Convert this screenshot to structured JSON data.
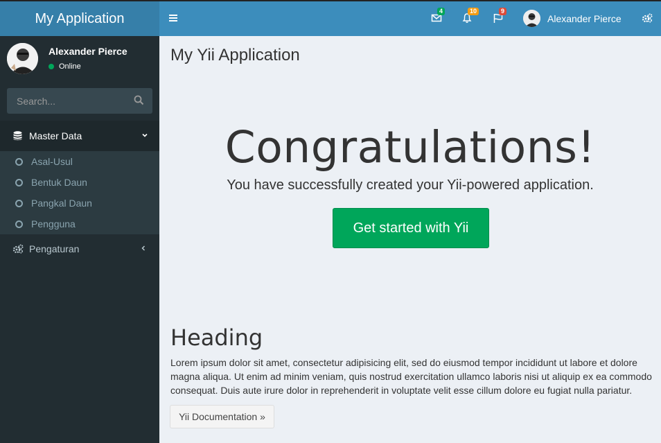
{
  "app": {
    "title": "My Application"
  },
  "navbar": {
    "messages_count": "4",
    "notifications_count": "10",
    "tasks_count": "9",
    "user_name": "Alexander Pierce",
    "colors": {
      "messages": "#00a65a",
      "notifications": "#f39c12",
      "tasks": "#dd4b39"
    }
  },
  "sidebar": {
    "user_name": "Alexander Pierce",
    "status": "Online",
    "search_placeholder": "Search...",
    "menu": [
      {
        "label": "Master Data",
        "icon": "database-icon",
        "expanded": true,
        "children": [
          "Asal-Usul",
          "Bentuk Daun",
          "Pangkal Daun",
          "Pengguna"
        ]
      },
      {
        "label": "Pengaturan",
        "icon": "gears-icon",
        "expanded": false
      }
    ]
  },
  "content": {
    "page_title": "My Yii Application",
    "jumbotron_title": "Congratulations!",
    "lead": "You have successfully created your Yii-powered application.",
    "cta_label": "Get started with Yii",
    "heading": "Heading",
    "paragraph": "Lorem ipsum dolor sit amet, consectetur adipisicing elit, sed do eiusmod tempor incididunt ut labore et dolore magna aliqua. Ut enim ad minim veniam, quis nostrud exercitation ullamco laboris nisi ut aliquip ex ea commodo consequat. Duis aute irure dolor in reprehenderit in voluptate velit esse cillum dolore eu fugiat nulla pariatur.",
    "docs_button": "Yii Documentation »"
  }
}
